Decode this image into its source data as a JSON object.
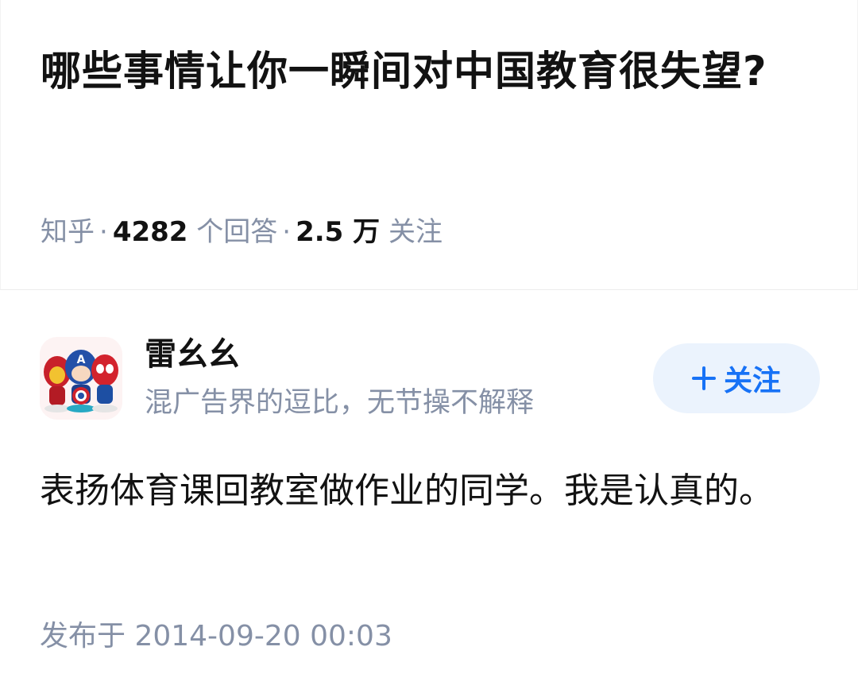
{
  "question": {
    "title": "哪些事情让你一瞬间对中国教育很失望?",
    "meta": {
      "source": "知乎",
      "separator": "·",
      "answer_count": "4282",
      "answer_label": "个回答",
      "follower_count": "2.5 万",
      "follower_label": "关注"
    }
  },
  "answer": {
    "author": {
      "avatar_icon": "superhero-figurines-avatar-icon",
      "name": "雷幺幺",
      "bio": "混广告界的逗比，无节操不解释"
    },
    "follow_button": {
      "icon": "plus-icon",
      "label": "关注",
      "color": "#1772f6",
      "background": "#ebf3fd"
    },
    "content": "表扬体育课回教室做作业的同学。我是认真的。",
    "published": "发布于 2014-09-20 00:03"
  }
}
